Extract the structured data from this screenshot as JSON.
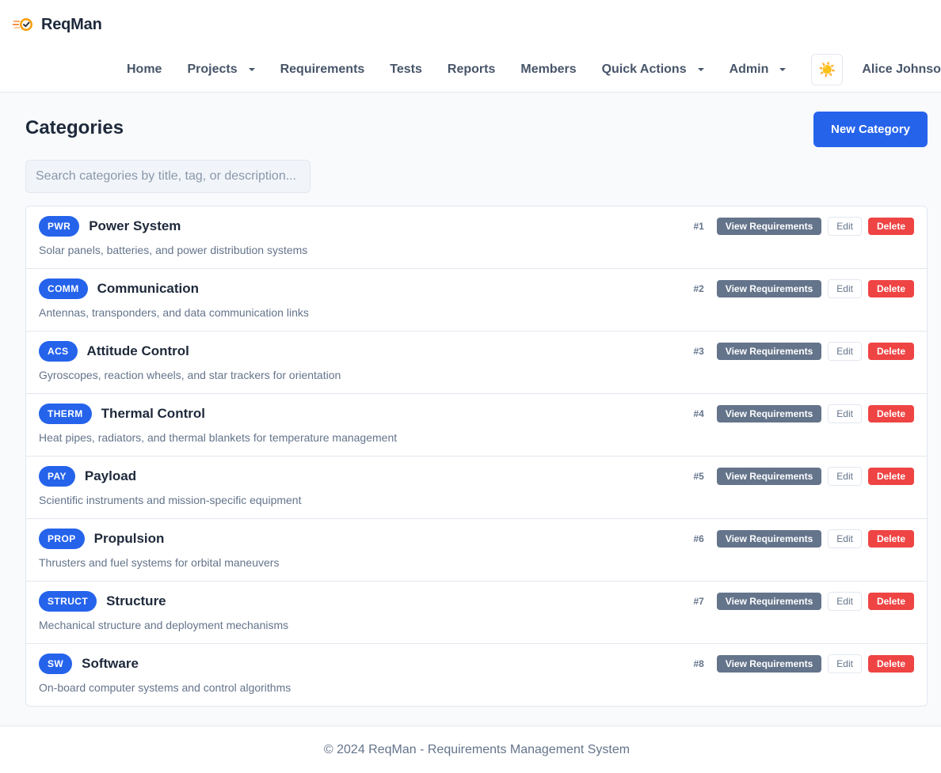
{
  "brand": {
    "name": "ReqMan",
    "logo_icon": "rocket-check-icon"
  },
  "nav": {
    "items": [
      {
        "label": "Home",
        "dropdown": false
      },
      {
        "label": "Projects",
        "dropdown": true
      },
      {
        "label": "Requirements",
        "dropdown": false
      },
      {
        "label": "Tests",
        "dropdown": false
      },
      {
        "label": "Reports",
        "dropdown": false
      },
      {
        "label": "Members",
        "dropdown": false
      },
      {
        "label": "Quick Actions",
        "dropdown": true
      },
      {
        "label": "Admin",
        "dropdown": true
      }
    ],
    "theme_icon": "☀️",
    "user": "Alice Johnson"
  },
  "page": {
    "title": "Categories",
    "new_button": "New Category",
    "search_placeholder": "Search categories by title, tag, or description..."
  },
  "actions": {
    "view": "View Requirements",
    "edit": "Edit",
    "delete": "Delete"
  },
  "categories": [
    {
      "tag": "PWR",
      "title": "Power System",
      "description": "Solar panels, batteries, and power distribution systems",
      "id": "#1"
    },
    {
      "tag": "COMM",
      "title": "Communication",
      "description": "Antennas, transponders, and data communication links",
      "id": "#2"
    },
    {
      "tag": "ACS",
      "title": "Attitude Control",
      "description": "Gyroscopes, reaction wheels, and star trackers for orientation",
      "id": "#3"
    },
    {
      "tag": "THERM",
      "title": "Thermal Control",
      "description": "Heat pipes, radiators, and thermal blankets for temperature management",
      "id": "#4"
    },
    {
      "tag": "PAY",
      "title": "Payload",
      "description": "Scientific instruments and mission-specific equipment",
      "id": "#5"
    },
    {
      "tag": "PROP",
      "title": "Propulsion",
      "description": "Thrusters and fuel systems for orbital maneuvers",
      "id": "#6"
    },
    {
      "tag": "STRUCT",
      "title": "Structure",
      "description": "Mechanical structure and deployment mechanisms",
      "id": "#7"
    },
    {
      "tag": "SW",
      "title": "Software",
      "description": "On-board computer systems and control algorithms",
      "id": "#8"
    }
  ],
  "footer": {
    "text": "© 2024 ReqMan - Requirements Management System"
  },
  "colors": {
    "primary": "#2563eb",
    "secondary": "#64748b",
    "danger": "#ef4444"
  }
}
